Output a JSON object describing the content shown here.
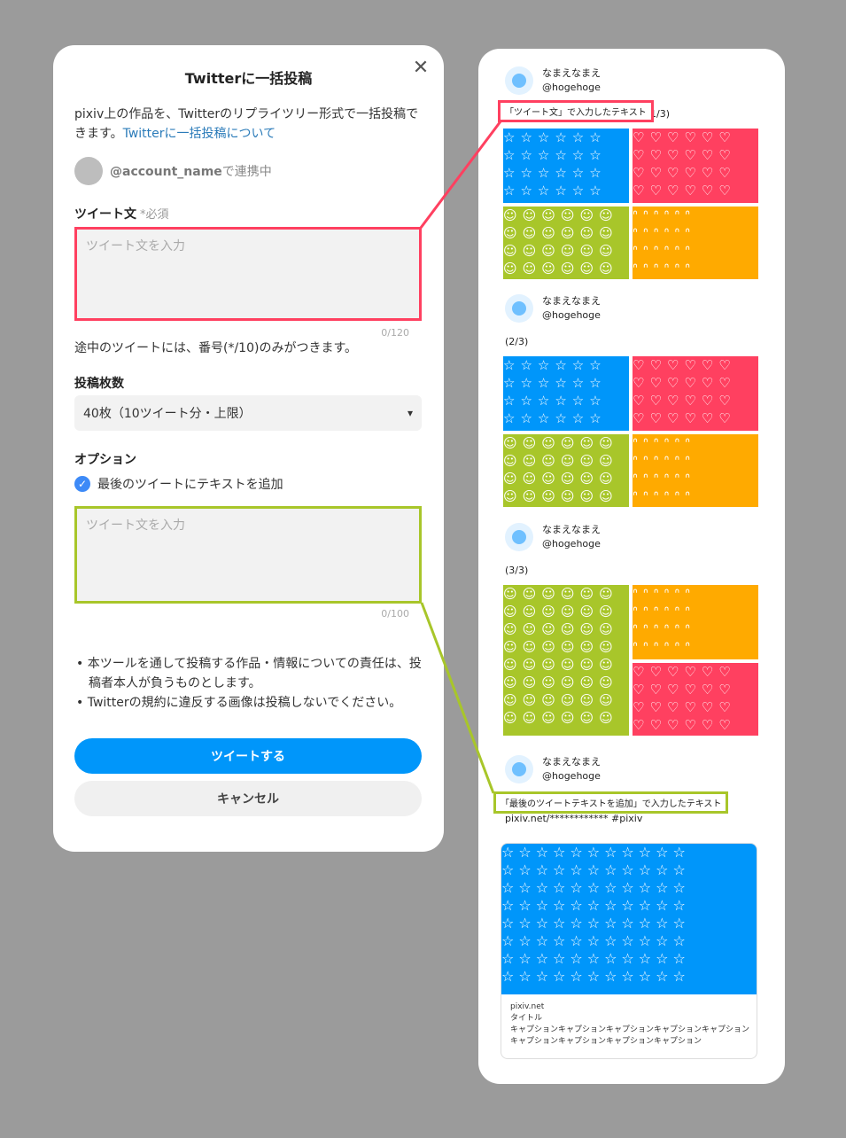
{
  "modal": {
    "title": "Twitterに一括投稿",
    "description": "pixiv上の作品を、Twitterのリプライツリー形式で一括投稿できます。",
    "description_link": "Twitterに一括投稿について",
    "account_name": "@account_name",
    "account_suffix": "で連携中",
    "tweet_label": "ツイート文",
    "required": "*必須",
    "tweet_placeholder": "ツイート文を入力",
    "tweet_counter": "0/120",
    "note": "途中のツイートには、番号(*/10)のみがつきます。",
    "count_label": "投稿枚数",
    "count_selected": "40枚（10ツイート分・上限）",
    "options_label": "オプション",
    "option_checkbox_label": "最後のツイートにテキストを追加",
    "extra_placeholder": "ツイート文を入力",
    "extra_counter": "0/100",
    "bullets": [
      "本ツールを通して投稿する作品・情報についての責任は、投稿者本人が負うものとします。",
      "Twitterの規約に違反する画像は投稿しないでください。"
    ],
    "tweet_button": "ツイートする",
    "cancel_button": "キャンセル"
  },
  "preview": {
    "display_name": "なまえなまえ",
    "handle": "@hogehoge",
    "tweets": [
      {
        "text": "1/3)"
      },
      {
        "text": "(2/3)"
      },
      {
        "text": "(3/3)"
      },
      {
        "text": "pixiv.net/************ #pixiv"
      }
    ],
    "callout_tweet": "「ツイート文」で入力したテキスト",
    "callout_last": "「最後のツイートテキストを追加」で入力したテキスト",
    "link_card": {
      "domain": "pixiv.net",
      "title": "タイトル",
      "caption": "キャプションキャプションキャプションキャプションキャプションキャプションキャプションキャプションキャプション"
    }
  },
  "colors": {
    "accent_blue": "#0096fa",
    "highlight_pink": "#ff4060",
    "highlight_green": "#a8c62a",
    "tile_orange": "#ffaa00",
    "checkbox_blue": "#3d8af7"
  },
  "icons": [
    "close-icon",
    "chevron-down-icon",
    "checkmark-icon",
    "star-pattern",
    "heart-pattern",
    "smiley-pattern",
    "bunny-pattern"
  ]
}
